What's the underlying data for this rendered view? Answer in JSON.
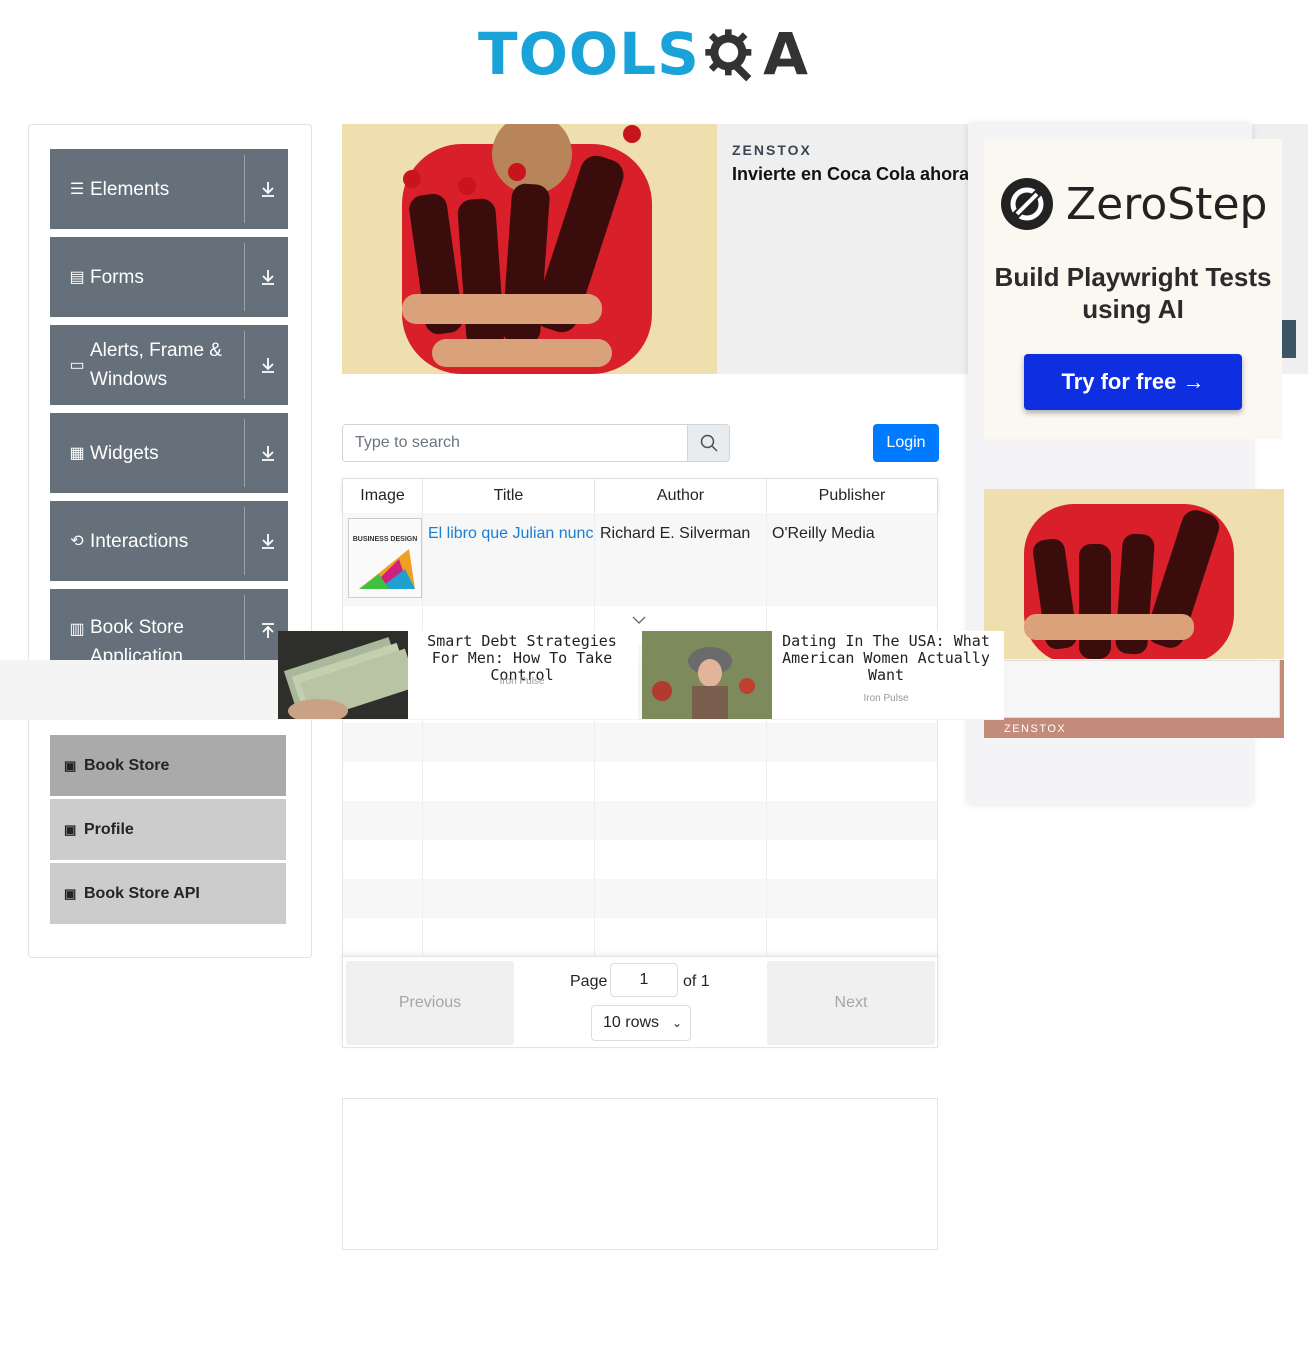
{
  "logo": {
    "tools": "TOOLS",
    "qa": "A"
  },
  "sidebar": {
    "groups": [
      {
        "label": "Elements",
        "icon": "hamburger-icon"
      },
      {
        "label": "Forms",
        "icon": "document-icon"
      },
      {
        "label": "Alerts, Frame & Windows",
        "icon": "window-icon"
      },
      {
        "label": "Widgets",
        "icon": "grid-icon"
      },
      {
        "label": "Interactions",
        "icon": "interactions-icon"
      },
      {
        "label": "Book Store Application",
        "icon": "books-icon"
      }
    ],
    "items": [
      {
        "label": "Book Store",
        "active": true
      },
      {
        "label": "Profile",
        "active": false
      },
      {
        "label": "Book Store API",
        "active": false
      }
    ]
  },
  "top_ad": {
    "brand": "ZENSTOX",
    "headline": "Invierte en Coca Cola ahora"
  },
  "right_ad": {
    "zerostep_name": "ZeroStep",
    "tagline": "Build Playwright Tests using AI",
    "cta": "Try for free →",
    "zenstox_label": "ZENSTOX"
  },
  "search": {
    "placeholder": "Type to search",
    "value": ""
  },
  "login": {
    "label": "Login"
  },
  "table": {
    "headers": [
      "Image",
      "Title",
      "Author",
      "Publisher"
    ],
    "rows": [
      {
        "title": "El libro que Julian nunca",
        "author": "Richard E. Silverman",
        "publisher": "O'Reilly Media",
        "cover_text": "BUSINESS DESIGN"
      }
    ]
  },
  "native_ads": [
    {
      "title": "Smart Debt Strategies For Men: How To Take Control",
      "source": "Iron Pulse"
    },
    {
      "title": "Dating In The USA: What American Women Actually Want",
      "source": "Iron Pulse"
    }
  ],
  "pagination": {
    "previous": "Previous",
    "next": "Next",
    "page_label": "Page",
    "page_value": "1",
    "of_label": "of 1",
    "rows_label": "10 rows"
  },
  "colors": {
    "group_bg": "#65707b",
    "login_bg": "#007bff",
    "logo_blue": "#1aa3d9",
    "zerostep_button": "#0d2fe0"
  }
}
